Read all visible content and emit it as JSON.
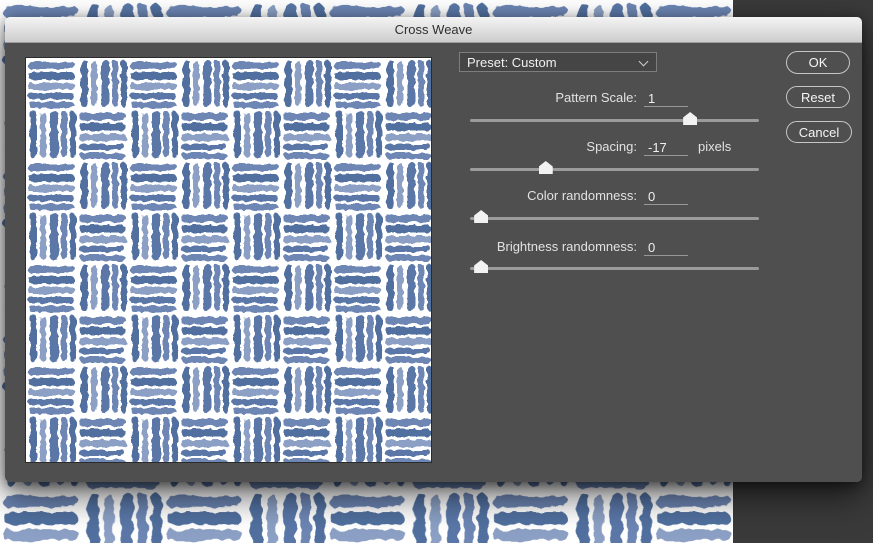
{
  "window": {
    "title": "Cross Weave"
  },
  "preset": {
    "value": "Preset: Custom"
  },
  "controls": [
    {
      "name": "pattern-scale",
      "label": "Pattern Scale:",
      "value": "1",
      "unit": "",
      "slider_percent": 77.5
    },
    {
      "name": "spacing",
      "label": "Spacing:",
      "value": "-17",
      "unit": "pixels",
      "slider_percent": 25
    },
    {
      "name": "color-randomness",
      "label": "Color randomness:",
      "value": "0",
      "unit": "",
      "slider_percent": 1.5
    },
    {
      "name": "brightness-randomness",
      "label": "Brightness randomness:",
      "value": "0",
      "unit": "",
      "slider_percent": 1.5
    }
  ],
  "buttons": [
    {
      "name": "ok",
      "label": "OK"
    },
    {
      "name": "reset",
      "label": "Reset"
    },
    {
      "name": "cancel",
      "label": "Cancel"
    }
  ],
  "colors": {
    "titlebar_top": "#f4f4f4",
    "titlebar_bottom": "#cdcdcd",
    "dialog_body": "#4f4f4f",
    "app_background": "#3a3a3a",
    "slider_track": "#9b9b9b",
    "canvas_background": "#ffffff",
    "pattern_blues": [
      "#51709f",
      "#6d86b4",
      "#7e94bd",
      "#5a77a8"
    ]
  }
}
